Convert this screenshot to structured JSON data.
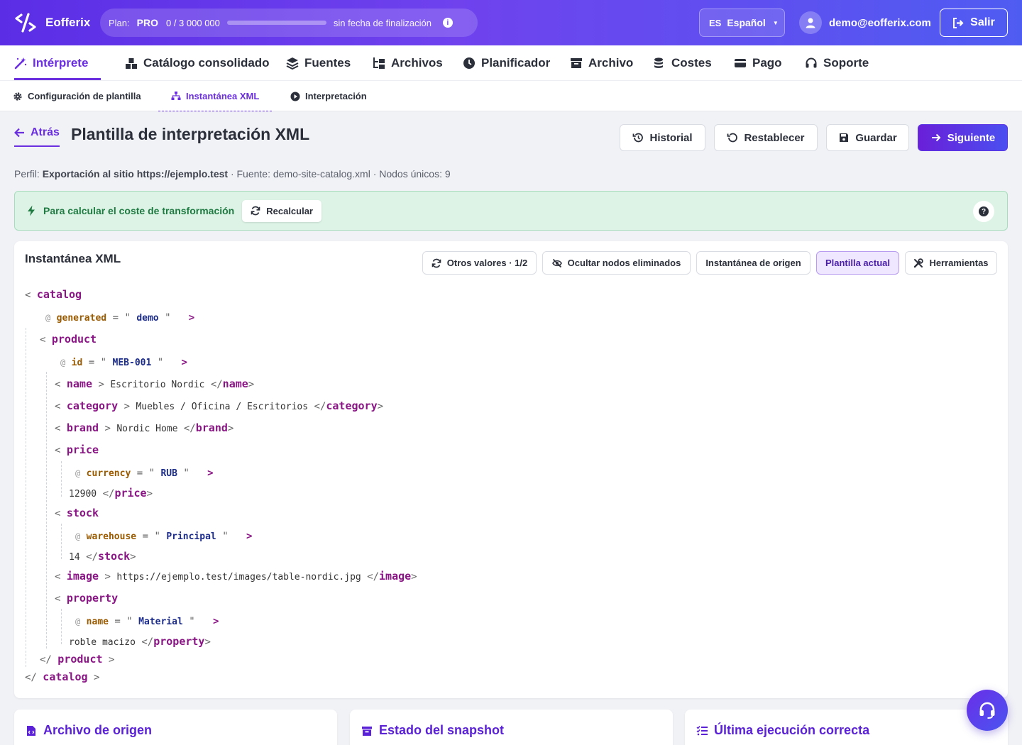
{
  "app": {
    "name": "Eofferix"
  },
  "plan": {
    "label": "Plan:",
    "name": "PRO",
    "usage": "0 / 3 000 000",
    "usage_fraction": 0.0,
    "until": "sin fecha de finalización"
  },
  "lang": {
    "code": "ES",
    "name": "Español"
  },
  "user": {
    "email": "demo@eofferix.com"
  },
  "logout_label": "Salir",
  "nav": [
    {
      "label": "Intérprete",
      "icon": "magic-wand-icon",
      "active": true
    },
    {
      "label": "Catálogo consolidado",
      "icon": "boxes-icon"
    },
    {
      "label": "Fuentes",
      "icon": "layers-icon"
    },
    {
      "label": "Archivos",
      "icon": "folder-tree-icon"
    },
    {
      "label": "Planificador",
      "icon": "clock-icon"
    },
    {
      "label": "Archivo",
      "icon": "archive-box-icon"
    },
    {
      "label": "Costes",
      "icon": "coins-icon"
    },
    {
      "label": "Pago",
      "icon": "credit-card-icon"
    },
    {
      "label": "Soporte",
      "icon": "headset-icon"
    }
  ],
  "subnav": [
    {
      "label": "Configuración de plantilla",
      "icon": "gear-icon"
    },
    {
      "label": "Instantánea XML",
      "icon": "sitemap-icon",
      "active": true
    },
    {
      "label": "Interpretación",
      "icon": "play-circle-icon"
    }
  ],
  "header": {
    "back": "Atrás",
    "title": "Plantilla de interpretación XML",
    "buttons": {
      "history": "Historial",
      "reset": "Restablecer",
      "save": "Guardar",
      "next": "Siguiente"
    }
  },
  "meta": {
    "profile_label": "Perfil:",
    "profile": "Exportación al sitio https://ejemplo.test",
    "source": "· Fuente: demo-site-catalog.xml · Nodos únicos: 9"
  },
  "alert": {
    "text": "Para calcular el coste de transformación",
    "button": "Recalcular"
  },
  "snapshot": {
    "title": "Instantánea XML",
    "tools": {
      "other": "Otros valores · 1/2",
      "hide": "Ocultar nodos eliminados",
      "origin": "Instantánea de origen",
      "current": "Plantilla actual",
      "tools": "Herramientas"
    },
    "xml": {
      "root": "catalog",
      "root_attr": {
        "name": "generated",
        "value": "demo"
      },
      "product": "product",
      "product_attr": {
        "name": "id",
        "value": "MEB-001"
      },
      "name_tag": "name",
      "name_val": "Escritorio Nordic",
      "category_tag": "category",
      "category_val": "Muebles / Oficina / Escritorios",
      "brand_tag": "brand",
      "brand_val": "Nordic Home",
      "price_tag": "price",
      "price_attr": {
        "name": "currency",
        "value": "RUB"
      },
      "price_val": "12900",
      "stock_tag": "stock",
      "stock_attr": {
        "name": "warehouse",
        "value": "Principal"
      },
      "stock_val": "14",
      "image_tag": "image",
      "image_val": "https://ejemplo.test/images/table-nordic.jpg",
      "property_tag": "property",
      "property_attr": {
        "name": "name",
        "value": "Material"
      },
      "property_val": "roble macizo"
    }
  },
  "bottom": {
    "origin": "Archivo de origen",
    "state": "Estado del snapshot",
    "last_run": "Última ejecución correcta"
  },
  "colors": {
    "brand": "#6b2fe0",
    "success_bg": "#dcf3e6",
    "tag": "#8a1585",
    "attr": "#9a5a00"
  }
}
